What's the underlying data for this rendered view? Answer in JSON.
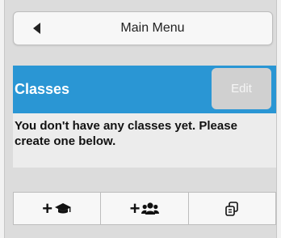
{
  "main_menu": {
    "label": "Main Menu",
    "icon": "back-arrow-icon"
  },
  "classes": {
    "title": "Classes",
    "edit_label": "Edit",
    "empty_message": "You don't have any classes yet. Please create one below."
  },
  "toolbar": {
    "add_class": {
      "plus": "+",
      "icon": "graduation-cap-icon"
    },
    "add_students": {
      "plus": "+",
      "icon": "users-icon"
    },
    "copy": {
      "icon": "copy-icon"
    }
  },
  "colors": {
    "header_blue": "#2a96d4",
    "edit_disabled": "#d0d0d0",
    "panel_bg": "#ececec"
  }
}
